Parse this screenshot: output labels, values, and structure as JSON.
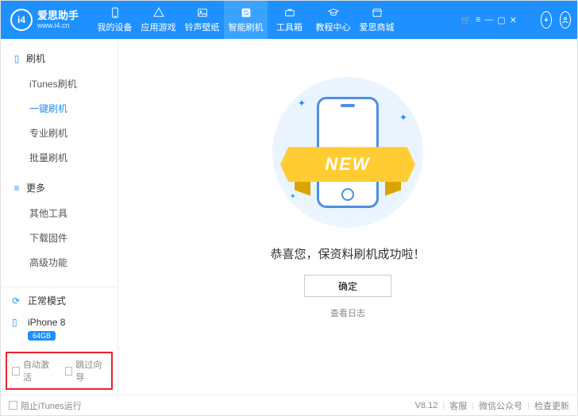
{
  "header": {
    "brand": "爱思助手",
    "url": "www.i4.cn",
    "nav": [
      "我的设备",
      "应用游戏",
      "铃声壁纸",
      "智能刷机",
      "工具箱",
      "教程中心",
      "爱思商城"
    ]
  },
  "sidebar": {
    "sections": [
      {
        "label": "刷机",
        "items": [
          "iTunes刷机",
          "一键刷机",
          "专业刷机",
          "批量刷机"
        ]
      },
      {
        "label": "更多",
        "items": [
          "其他工具",
          "下载固件",
          "高级功能"
        ]
      }
    ],
    "mode": "正常模式",
    "device": {
      "name": "iPhone 8",
      "storage": "64GB"
    },
    "opts": [
      "自动激活",
      "跳过向导"
    ]
  },
  "main": {
    "ribbon": "NEW",
    "success": "恭喜您，保资料刷机成功啦！",
    "ok": "确定",
    "log": "查看日志"
  },
  "footer": {
    "block_itunes": "阻止iTunes运行",
    "version": "V8.12",
    "links": [
      "客服",
      "微信公众号",
      "检查更新"
    ]
  }
}
